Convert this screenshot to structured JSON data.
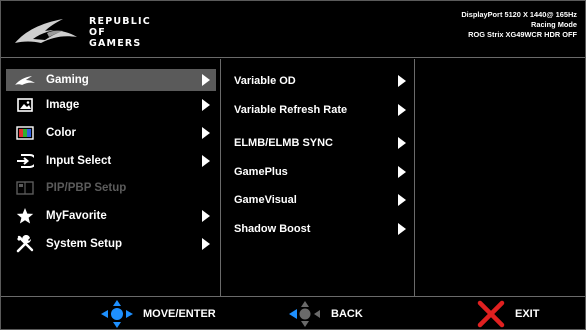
{
  "header": {
    "brand_line1": "REPUBLIC OF",
    "brand_line2": "GAMERS",
    "status_line1": "DisplayPort 5120 X 1440@ 165Hz",
    "status_line2": "Racing Mode",
    "status_line3": "ROG Strix XG49WCR HDR OFF"
  },
  "main_menu": [
    {
      "label": "Gaming",
      "icon": "rog-eye-icon",
      "selected": true,
      "enabled": true
    },
    {
      "label": "Image",
      "icon": "image-icon",
      "selected": false,
      "enabled": true
    },
    {
      "label": "Color",
      "icon": "color-icon",
      "selected": false,
      "enabled": true
    },
    {
      "label": "Input Select",
      "icon": "input-select-icon",
      "selected": false,
      "enabled": true
    },
    {
      "label": "PIP/PBP Setup",
      "icon": "pip-pbp-icon",
      "selected": false,
      "enabled": false
    },
    {
      "label": "MyFavorite",
      "icon": "star-icon",
      "selected": false,
      "enabled": true
    },
    {
      "label": "System Setup",
      "icon": "tools-icon",
      "selected": false,
      "enabled": true
    }
  ],
  "sub_menu": [
    {
      "label": "Variable OD"
    },
    {
      "label": "Variable Refresh Rate"
    },
    {
      "label": "ELMB/ELMB SYNC"
    },
    {
      "label": "GamePlus"
    },
    {
      "label": "GameVisual"
    },
    {
      "label": "Shadow Boost"
    }
  ],
  "footer": {
    "move_enter": "MOVE/ENTER",
    "back": "BACK",
    "exit": "EXIT"
  },
  "colors": {
    "background": "#000000",
    "selected": "#5a5a5a",
    "navigator_blue": "#1e90ff",
    "exit_red": "#e02020",
    "disabled_text": "#5b5b5b"
  }
}
